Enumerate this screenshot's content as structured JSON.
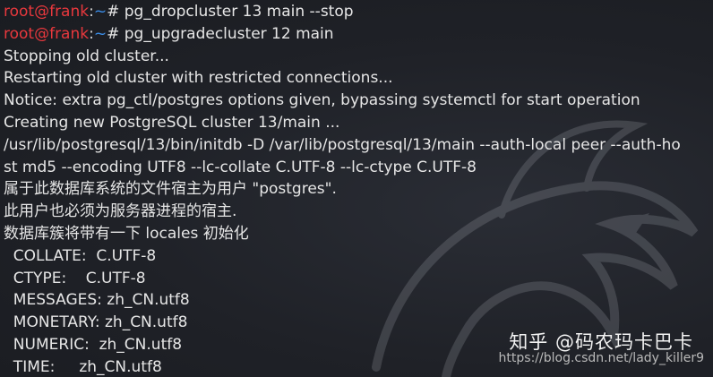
{
  "terminal": {
    "prompts": [
      {
        "user": "root@frank",
        "sep": ":",
        "path": "~",
        "hash": "# ",
        "command": "pg_dropcluster 13 main --stop"
      },
      {
        "user": "root@frank",
        "sep": ":",
        "path": "~",
        "hash": "# ",
        "command": "pg_upgradecluster 12 main"
      }
    ],
    "output": [
      "Stopping old cluster...",
      "Restarting old cluster with restricted connections...",
      "Notice: extra pg_ctl/postgres options given, bypassing systemctl for start operation",
      "Creating new PostgreSQL cluster 13/main ...",
      "/usr/lib/postgresql/13/bin/initdb -D /var/lib/postgresql/13/main --auth-local peer --auth-ho",
      "st md5 --encoding UTF8 --lc-collate C.UTF-8 --lc-ctype C.UTF-8",
      "属于此数据库系统的文件宿主为用户 \"postgres\".",
      "此用户也必须为服务器进程的宿主.",
      "数据库簇将带有一下 locales 初始化",
      "  COLLATE:  C.UTF-8",
      "  CTYPE:    C.UTF-8",
      "  MESSAGES: zh_CN.utf8",
      "  MONETARY: zh_CN.utf8",
      "  NUMERIC:  zh_CN.utf8",
      "  TIME:     zh_CN.utf8"
    ]
  },
  "watermark": {
    "brand": "知乎 @码农玛卡巴卡",
    "url": "https://blog.csdn.net/lady_killer9"
  },
  "colors": {
    "background": "#1f2127",
    "prompt_user": "#e8383d",
    "prompt_path": "#3b8eea",
    "text": "#e6e6e6"
  },
  "icons": {
    "background_art": "kali-dragon-icon"
  }
}
